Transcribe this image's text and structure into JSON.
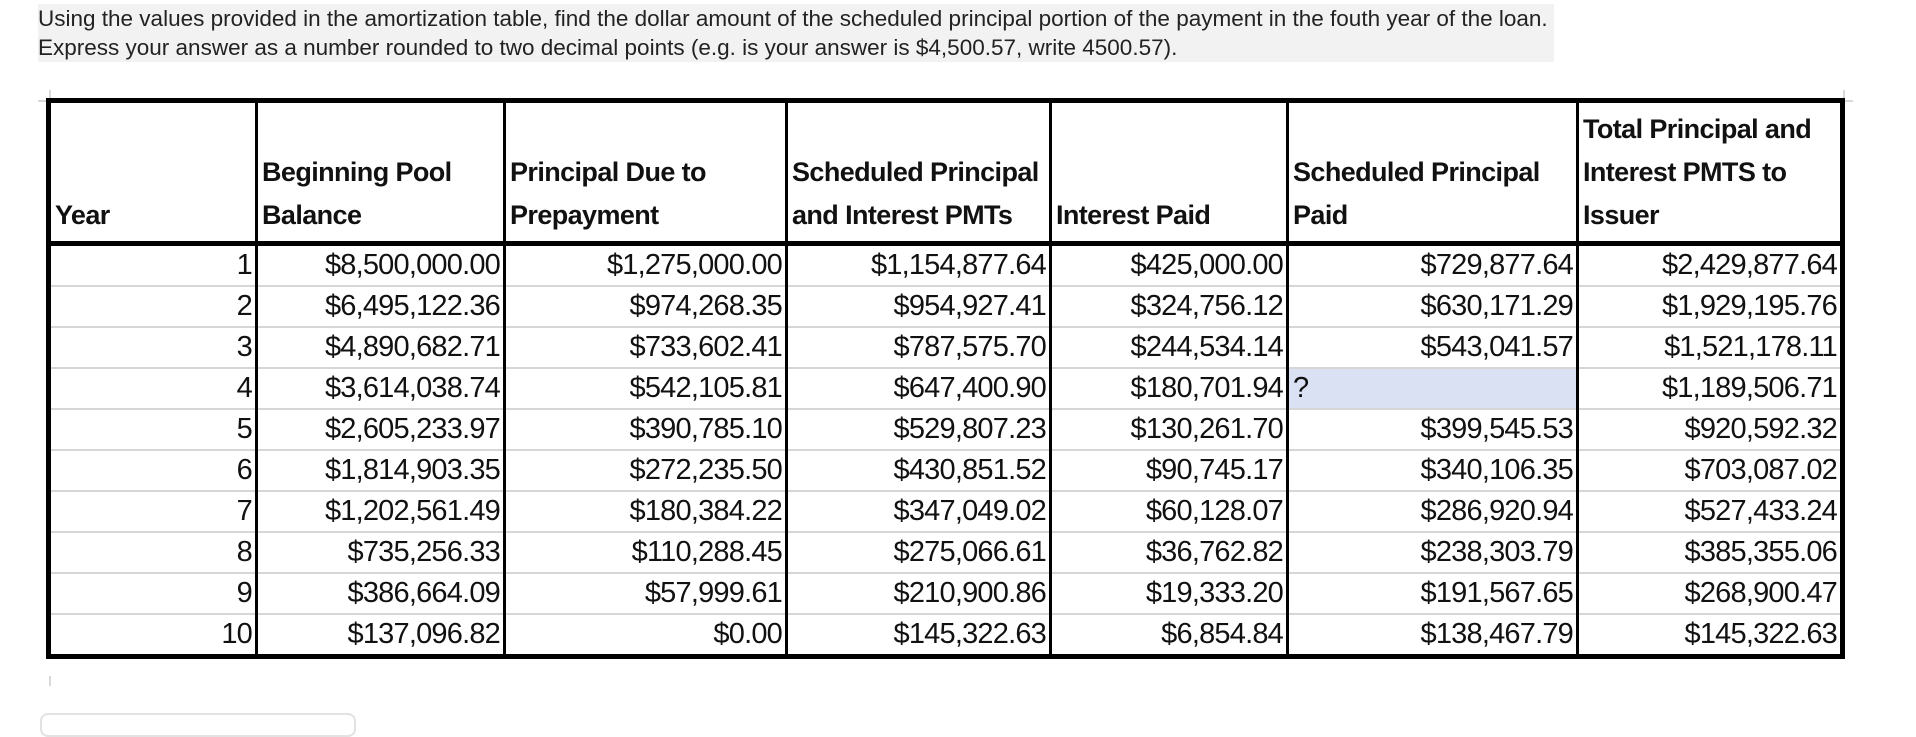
{
  "question": {
    "line1": "Using the values provided in the amortization table, find the dollar amount of the scheduled principal portion of the payment in the fouth year of the loan.",
    "line2": "Express your answer as a number rounded to two decimal points (e.g. is your answer is $4,500.57, write 4500.57)."
  },
  "table": {
    "headers": [
      "Year",
      "Beginning Pool Balance",
      "Principal Due to Prepayment",
      "Scheduled Principal and Interest PMTs",
      "Interest Paid",
      "Scheduled Principal Paid",
      "Total Principal and Interest PMTS to Issuer"
    ],
    "rows": [
      [
        "1",
        "$8,500,000.00",
        "$1,275,000.00",
        "$1,154,877.64",
        "$425,000.00",
        "$729,877.64",
        "$2,429,877.64"
      ],
      [
        "2",
        "$6,495,122.36",
        "$974,268.35",
        "$954,927.41",
        "$324,756.12",
        "$630,171.29",
        "$1,929,195.76"
      ],
      [
        "3",
        "$4,890,682.71",
        "$733,602.41",
        "$787,575.70",
        "$244,534.14",
        "$543,041.57",
        "$1,521,178.11"
      ],
      [
        "4",
        "$3,614,038.74",
        "$542,105.81",
        "$647,400.90",
        "$180,701.94",
        "?",
        "$1,189,506.71"
      ],
      [
        "5",
        "$2,605,233.97",
        "$390,785.10",
        "$529,807.23",
        "$130,261.70",
        "$399,545.53",
        "$920,592.32"
      ],
      [
        "6",
        "$1,814,903.35",
        "$272,235.50",
        "$430,851.52",
        "$90,745.17",
        "$340,106.35",
        "$703,087.02"
      ],
      [
        "7",
        "$1,202,561.49",
        "$180,384.22",
        "$347,049.02",
        "$60,128.07",
        "$286,920.94",
        "$527,433.24"
      ],
      [
        "8",
        "$735,256.33",
        "$110,288.45",
        "$275,066.61",
        "$36,762.82",
        "$238,303.79",
        "$385,355.06"
      ],
      [
        "9",
        "$386,664.09",
        "$57,999.61",
        "$210,900.86",
        "$19,333.20",
        "$191,567.65",
        "$268,900.47"
      ],
      [
        "10",
        "$137,096.82",
        "$0.00",
        "$145,322.63",
        "$6,854.84",
        "$138,467.79",
        "$145,322.63"
      ]
    ],
    "missing_cell_fill": "#d9e1f2"
  },
  "answer": {
    "value": ""
  }
}
